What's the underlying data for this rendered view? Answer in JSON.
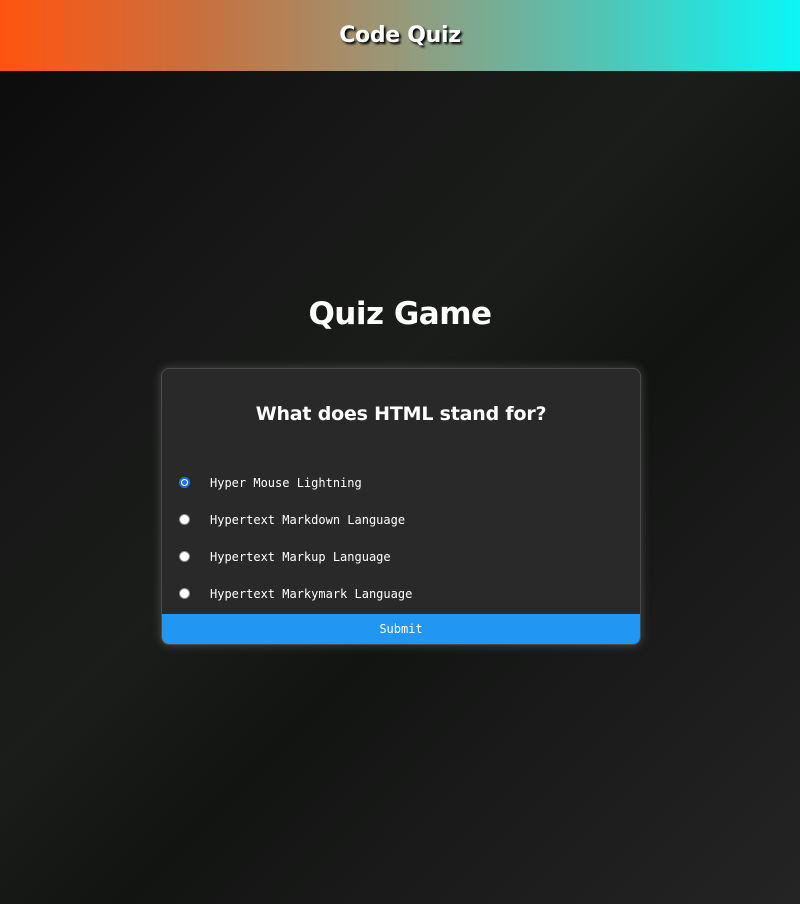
{
  "header": {
    "title": "Code Quiz"
  },
  "main": {
    "title": "Quiz Game"
  },
  "quiz": {
    "question": "What does HTML stand for?",
    "answers": [
      {
        "label": "Hyper Mouse Lightning",
        "selected": true
      },
      {
        "label": "Hypertext Markdown Language",
        "selected": false
      },
      {
        "label": "Hypertext Markup Language",
        "selected": false
      },
      {
        "label": "Hypertext Markymark Language",
        "selected": false
      }
    ],
    "submit_label": "Submit"
  },
  "colors": {
    "submit": "#2196f3",
    "card_bg": "#292929",
    "header_gradient_start": "#ff5410",
    "header_gradient_end": "#0bf6f6",
    "radio_selected": "#1a73e8"
  }
}
